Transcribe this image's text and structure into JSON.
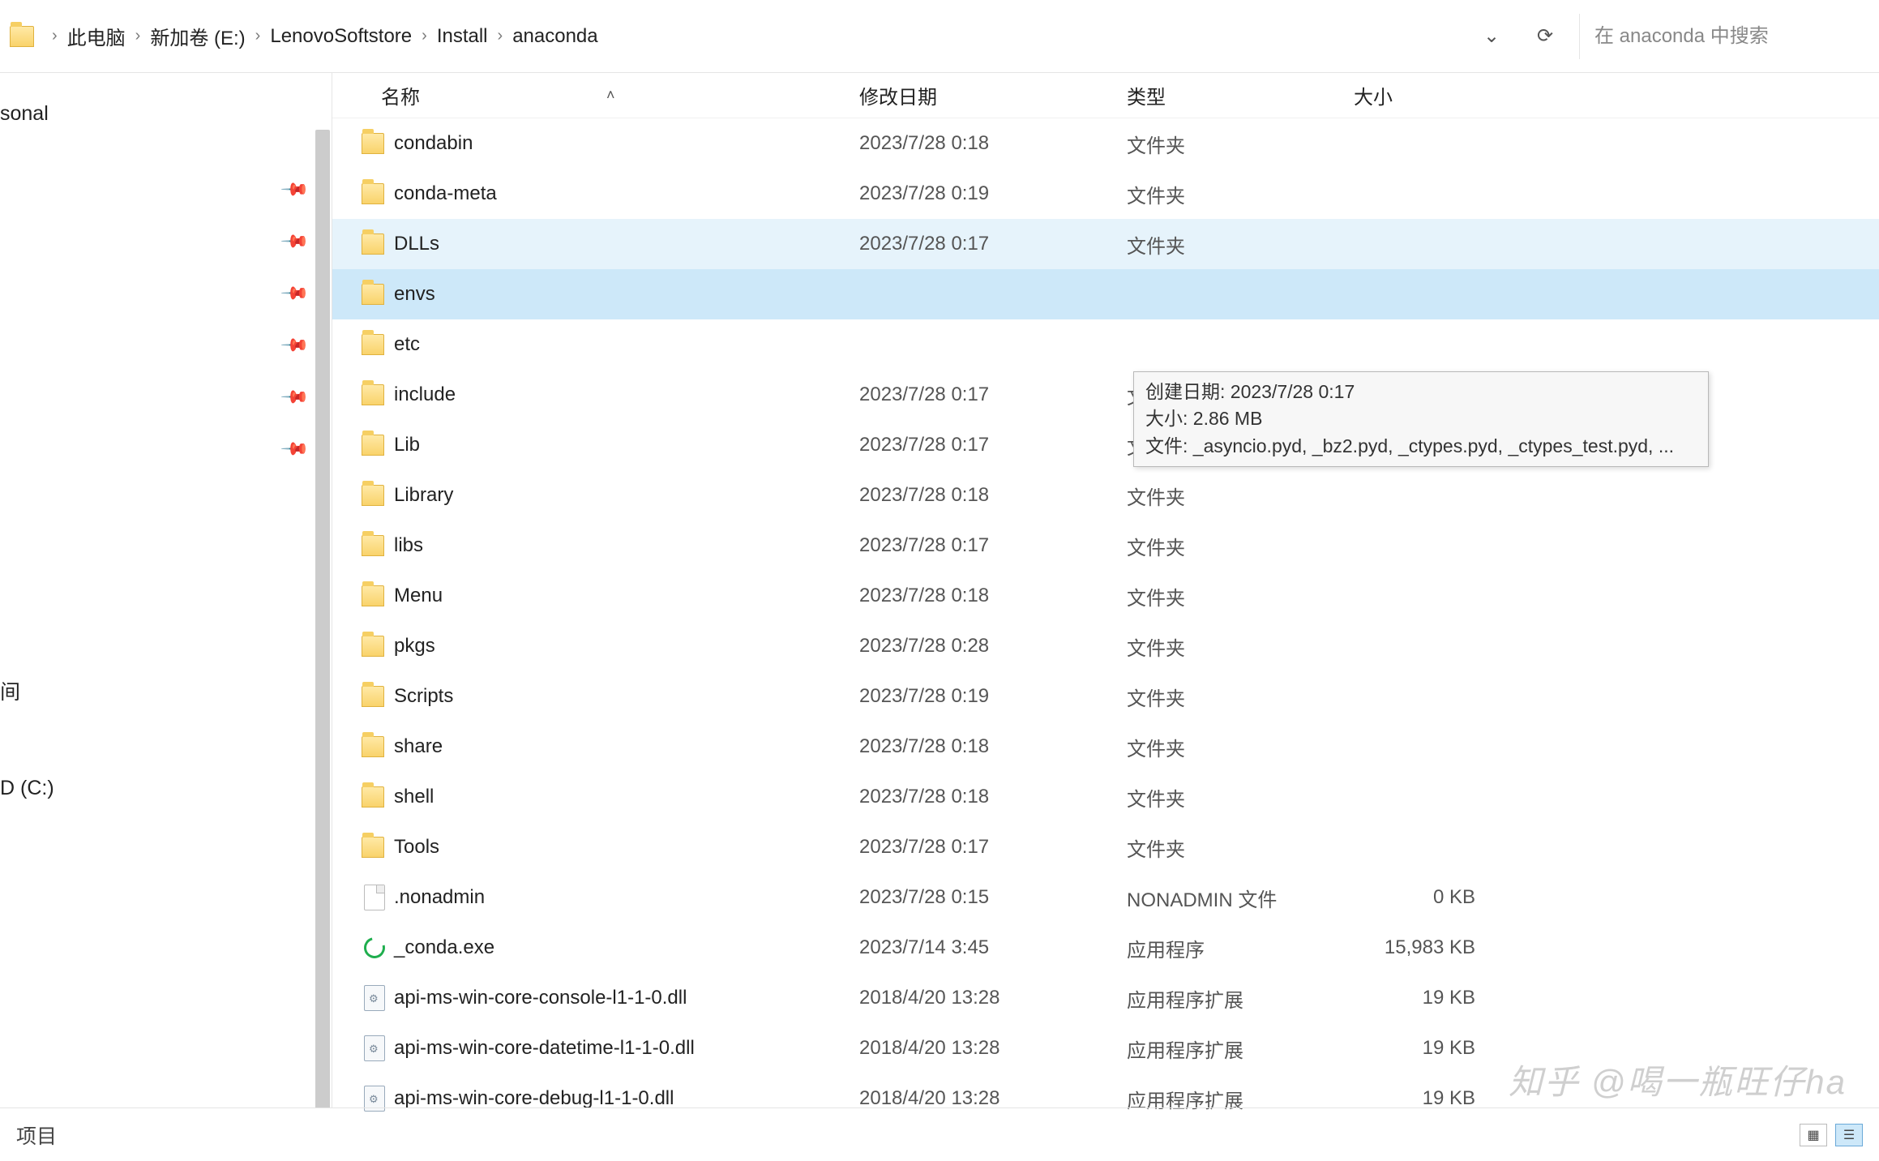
{
  "breadcrumb": [
    "此电脑",
    "新加卷 (E:)",
    "LenovoSoftstore",
    "Install",
    "anaconda"
  ],
  "search": {
    "placeholder": "在 anaconda 中搜索"
  },
  "nav": {
    "personal_label": "sonal",
    "pinned": [
      "",
      "",
      "",
      "",
      "",
      ""
    ],
    "group_labels": [
      "间",
      "",
      "D (C:)"
    ]
  },
  "columns": {
    "name": "名称",
    "date": "修改日期",
    "type": "类型",
    "size": "大小"
  },
  "rows": [
    {
      "icon": "folder",
      "name": "condabin",
      "date": "2023/7/28 0:18",
      "type": "文件夹",
      "size": ""
    },
    {
      "icon": "folder",
      "name": "conda-meta",
      "date": "2023/7/28 0:19",
      "type": "文件夹",
      "size": ""
    },
    {
      "icon": "folder",
      "name": "DLLs",
      "date": "2023/7/28 0:17",
      "type": "文件夹",
      "size": "",
      "state": "hover"
    },
    {
      "icon": "folder",
      "name": "envs",
      "date": "",
      "type": "",
      "size": "",
      "state": "sel"
    },
    {
      "icon": "folder",
      "name": "etc",
      "date": "",
      "type": "",
      "size": ""
    },
    {
      "icon": "folder",
      "name": "include",
      "date": "2023/7/28 0:17",
      "type": "文件夹",
      "size": ""
    },
    {
      "icon": "folder",
      "name": "Lib",
      "date": "2023/7/28 0:17",
      "type": "文件夹",
      "size": ""
    },
    {
      "icon": "folder",
      "name": "Library",
      "date": "2023/7/28 0:18",
      "type": "文件夹",
      "size": ""
    },
    {
      "icon": "folder",
      "name": "libs",
      "date": "2023/7/28 0:17",
      "type": "文件夹",
      "size": ""
    },
    {
      "icon": "folder",
      "name": "Menu",
      "date": "2023/7/28 0:18",
      "type": "文件夹",
      "size": ""
    },
    {
      "icon": "folder",
      "name": "pkgs",
      "date": "2023/7/28 0:28",
      "type": "文件夹",
      "size": ""
    },
    {
      "icon": "folder",
      "name": "Scripts",
      "date": "2023/7/28 0:19",
      "type": "文件夹",
      "size": ""
    },
    {
      "icon": "folder",
      "name": "share",
      "date": "2023/7/28 0:18",
      "type": "文件夹",
      "size": ""
    },
    {
      "icon": "folder",
      "name": "shell",
      "date": "2023/7/28 0:18",
      "type": "文件夹",
      "size": ""
    },
    {
      "icon": "folder",
      "name": "Tools",
      "date": "2023/7/28 0:17",
      "type": "文件夹",
      "size": ""
    },
    {
      "icon": "file",
      "name": ".nonadmin",
      "date": "2023/7/28 0:15",
      "type": "NONADMIN 文件",
      "size": "0 KB"
    },
    {
      "icon": "exe",
      "name": "_conda.exe",
      "date": "2023/7/14 3:45",
      "type": "应用程序",
      "size": "15,983 KB"
    },
    {
      "icon": "dll",
      "name": "api-ms-win-core-console-l1-1-0.dll",
      "date": "2018/4/20 13:28",
      "type": "应用程序扩展",
      "size": "19 KB"
    },
    {
      "icon": "dll",
      "name": "api-ms-win-core-datetime-l1-1-0.dll",
      "date": "2018/4/20 13:28",
      "type": "应用程序扩展",
      "size": "19 KB"
    },
    {
      "icon": "dll",
      "name": "api-ms-win-core-debug-l1-1-0.dll",
      "date": "2018/4/20 13:28",
      "type": "应用程序扩展",
      "size": "19 KB"
    }
  ],
  "tooltip": {
    "line1": "创建日期: 2023/7/28 0:17",
    "line2": "大小: 2.86 MB",
    "line3": "文件: _asyncio.pyd, _bz2.pyd, _ctypes.pyd, _ctypes_test.pyd, ..."
  },
  "status": {
    "text": "项目"
  },
  "watermark": "知乎 @喝一瓶旺仔ha"
}
